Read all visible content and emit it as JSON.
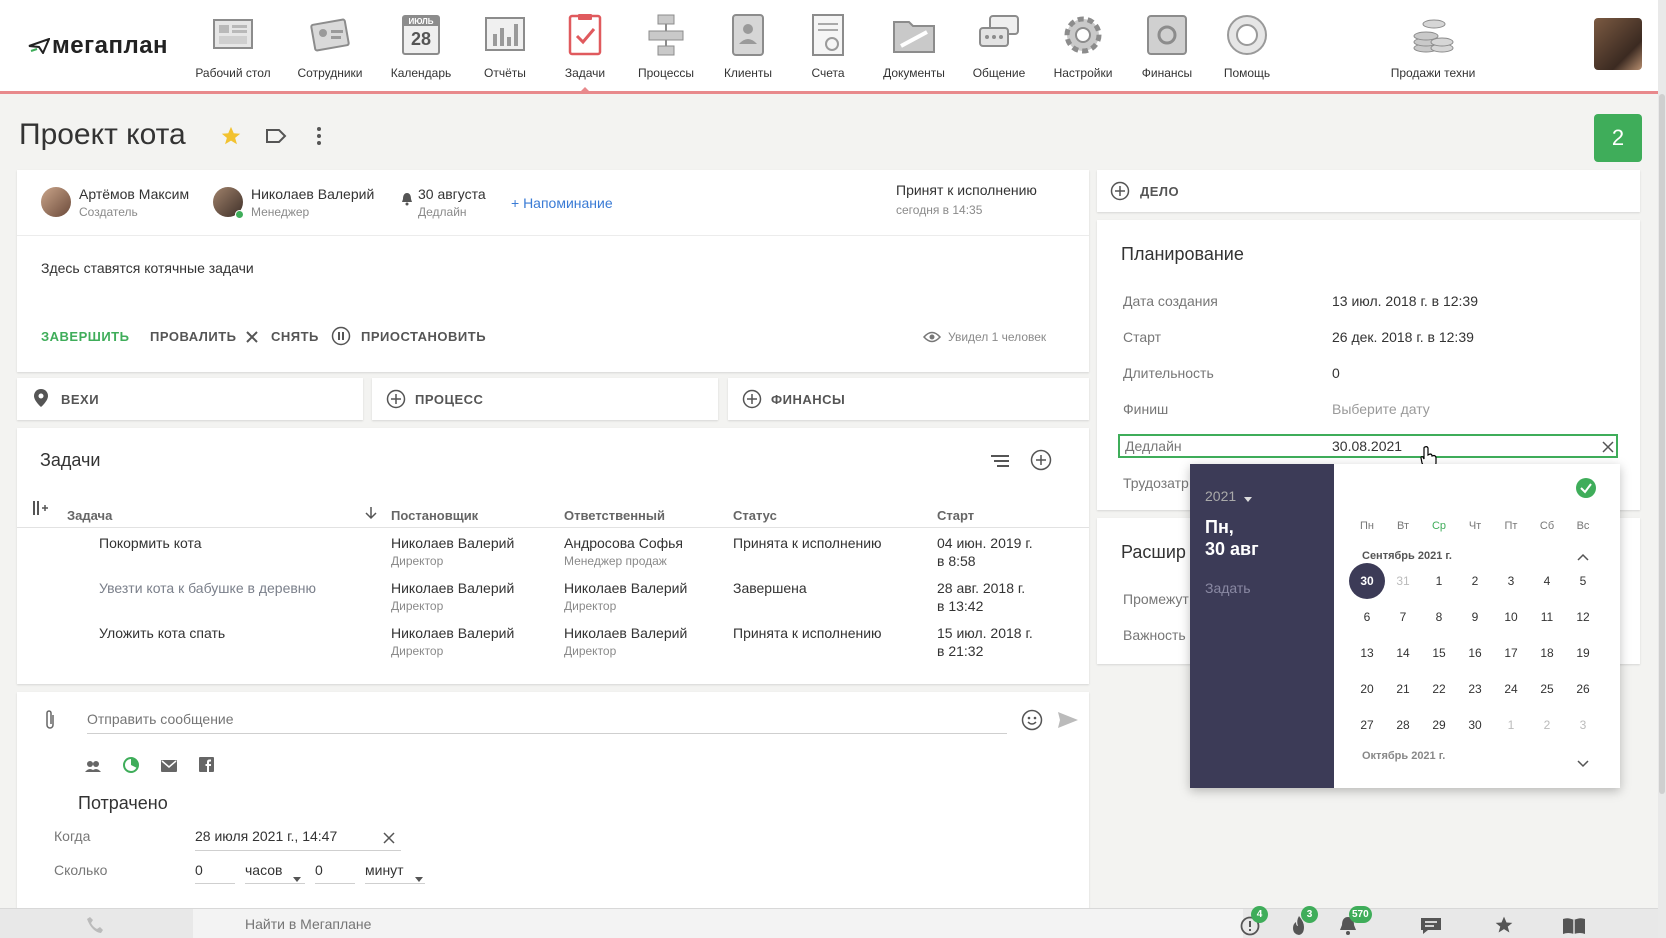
{
  "header": {
    "logo": "мегаплан",
    "nav": [
      {
        "label": "Рабочий стол",
        "icon": "desktop-icon"
      },
      {
        "label": "Сотрудники",
        "icon": "employees-icon"
      },
      {
        "label": "Календарь",
        "icon": "calendar-icon",
        "cal_month": "ИЮЛЬ",
        "cal_day": "28"
      },
      {
        "label": "Отчёты",
        "icon": "reports-icon"
      },
      {
        "label": "Задачи",
        "icon": "tasks-icon"
      },
      {
        "label": "Процессы",
        "icon": "processes-icon"
      },
      {
        "label": "Клиенты",
        "icon": "clients-icon"
      },
      {
        "label": "Счета",
        "icon": "invoices-icon"
      },
      {
        "label": "Документы",
        "icon": "documents-icon"
      },
      {
        "label": "Общение",
        "icon": "chat-icon"
      },
      {
        "label": "Настройки",
        "icon": "settings-icon"
      },
      {
        "label": "Финансы",
        "icon": "finance-icon"
      },
      {
        "label": "Помощь",
        "icon": "help-icon"
      },
      {
        "label": "Продажи техни",
        "icon": "sales-icon"
      }
    ],
    "active_nav": "Задачи"
  },
  "page": {
    "title": "Проект кота",
    "notifications_count": "2"
  },
  "task": {
    "creator": {
      "name": "Артёмов Максим",
      "role": "Создатель"
    },
    "manager": {
      "name": "Николаев Валерий",
      "role": "Менеджер"
    },
    "deadline": {
      "date": "30 августа",
      "label": "Дедлайн"
    },
    "reminder_link": "+ Напоминание",
    "status": {
      "text": "Принят к исполнению",
      "time": "сегодня в 14:35"
    },
    "description": "Здесь ставятся котячные задачи",
    "actions": {
      "complete": "ЗАВЕРШИТЬ",
      "fail": "ПРОВАЛИТЬ",
      "remove": "СНЯТЬ",
      "pause": "ПРИОСТАНОВИТЬ"
    },
    "seen": "Увидел 1 человек"
  },
  "sections": {
    "milestones": "ВЕХИ",
    "process": "ПРОЦЕСС",
    "finance": "ФИНАНСЫ",
    "deal": "ДЕЛО"
  },
  "subtasks": {
    "title": "Задачи",
    "columns": [
      "Задача",
      "Постановщик",
      "Ответственный",
      "Статус",
      "Старт"
    ],
    "rows": [
      {
        "task": "Покормить кота",
        "setter": "Николаев Валерий",
        "setter_role": "Директор",
        "resp": "Андросова Софья",
        "resp_role": "Менеджер продаж",
        "status": "Принята к исполнению",
        "start": "04 июн. 2019 г.",
        "start2": "в 8:58",
        "done": false
      },
      {
        "task": "Увезти кота к бабушке в деревню",
        "setter": "Николаев Валерий",
        "setter_role": "Директор",
        "resp": "Николаев Валерий",
        "resp_role": "Директор",
        "status": "Завершена",
        "start": "28 авг. 2018 г.",
        "start2": "в 13:42",
        "done": true
      },
      {
        "task": "Уложить кота спать",
        "setter": "Николаев Валерий",
        "setter_role": "Директор",
        "resp": "Николаев Валерий",
        "resp_role": "Директор",
        "status": "Принята к исполнению",
        "start": "15 июл. 2018 г.",
        "start2": "в 21:32",
        "done": false
      }
    ]
  },
  "message": {
    "placeholder": "Отправить сообщение"
  },
  "spent": {
    "title": "Потрачено",
    "when_label": "Когда",
    "when_value": "28 июля 2021 г., 14:47",
    "how_much_label": "Сколько",
    "hours_value": "0",
    "hours_unit": "часов",
    "minutes_value": "0",
    "minutes_unit": "минут"
  },
  "planning": {
    "title": "Планирование",
    "created_label": "Дата создания",
    "created_value": "13 июл. 2018 г. в 12:39",
    "start_label": "Старт",
    "start_value": "26 дек. 2018 г. в 12:39",
    "duration_label": "Длительность",
    "duration_value": "0",
    "finish_label": "Финиш",
    "finish_placeholder": "Выберите дату",
    "deadline_label": "Дедлайн",
    "deadline_value": "30.08.2021",
    "labor_label": "Трудозатр"
  },
  "extended": {
    "title": "Расшир",
    "interval_label": "Промежут",
    "importance_label": "Важность"
  },
  "calendar": {
    "year": "2021",
    "weekday_short": "Пн,",
    "date_short": "30 авг",
    "set_label": "Задать",
    "weekdays": [
      "Пн",
      "Вт",
      "Ср",
      "Чт",
      "Пт",
      "Сб",
      "Вс"
    ],
    "month_label": "Сентябрь 2021 г.",
    "next_month_label": "Октябрь 2021 г.",
    "weeks": [
      [
        "30",
        "31",
        "1",
        "2",
        "3",
        "4",
        "5"
      ],
      [
        "6",
        "7",
        "8",
        "9",
        "10",
        "11",
        "12"
      ],
      [
        "13",
        "14",
        "15",
        "16",
        "17",
        "18",
        "19"
      ],
      [
        "20",
        "21",
        "22",
        "23",
        "24",
        "25",
        "26"
      ],
      [
        "27",
        "28",
        "29",
        "30",
        "1",
        "2",
        "3"
      ]
    ]
  },
  "footer": {
    "search_placeholder": "Найти в Мегаплане",
    "alerts_count": "4",
    "hot_count": "3",
    "bell_count": "570"
  },
  "colors": {
    "accent_red": "#e8898c",
    "green": "#3fad5a",
    "calendar_dark": "#3c3b57",
    "link_blue": "#3a7bd5"
  }
}
